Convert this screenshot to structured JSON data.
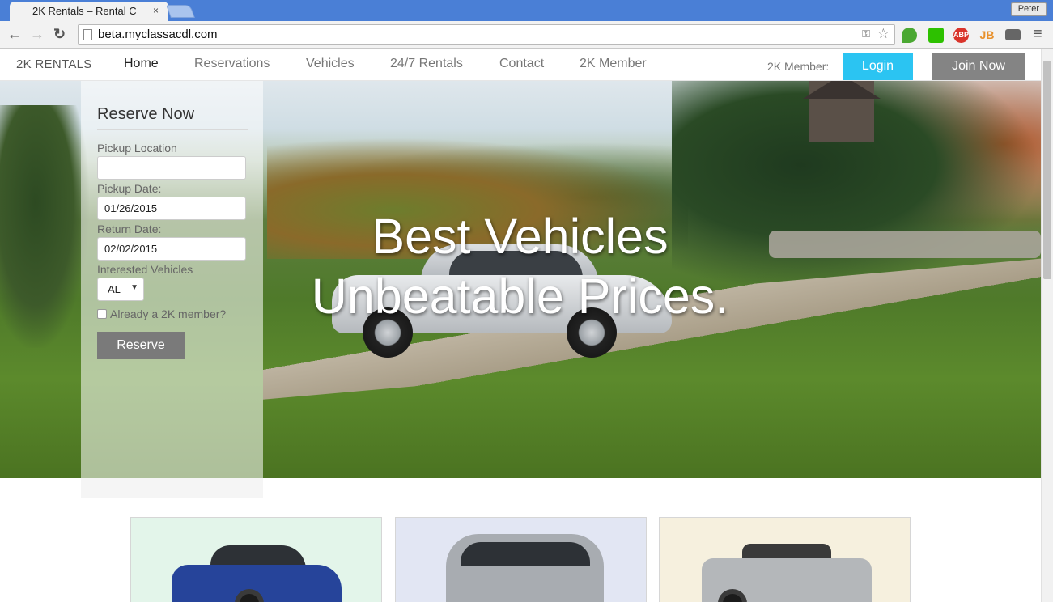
{
  "browser": {
    "tab_title": "2K Rentals – Rental C",
    "tab_close": "×",
    "profile_name": "Peter",
    "url": "beta.myclassacdl.com",
    "back_glyph": "←",
    "forward_glyph": "→",
    "reload_glyph": "↻",
    "menu_glyph": "≡",
    "star_glyph": "☆",
    "extensions": [
      {
        "name": "evernote-icon",
        "label": "",
        "color": "#4aa832"
      },
      {
        "name": "wechat-icon",
        "label": "",
        "color": "#2dc100"
      },
      {
        "name": "adblock-plus-icon",
        "label": "ABP",
        "color": "#d9342b"
      },
      {
        "name": "jb-icon",
        "label": "JB",
        "color": "#f0a030"
      },
      {
        "name": "mail-icon",
        "label": "",
        "color": "#666666"
      }
    ]
  },
  "nav": {
    "brand": "2K RENTALS",
    "links": [
      "Home",
      "Reservations",
      "Vehicles",
      "24/7 Rentals",
      "Contact",
      "2K Member"
    ],
    "active_index": 0,
    "member_label": "2K Member:",
    "login_label": "Login",
    "join_label": "Join Now"
  },
  "hero": {
    "headline_line1": "Best Vehicles",
    "headline_line2": "Unbeatable Prices."
  },
  "reserve_form": {
    "title": "Reserve Now",
    "pickup_location_label": "Pickup Location",
    "pickup_location_value": "",
    "pickup_date_label": "Pickup Date:",
    "pickup_date_value": "01/26/2015",
    "return_date_label": "Return Date:",
    "return_date_value": "02/02/2015",
    "vehicles_label": "Interested Vehicles",
    "vehicles_selected": "AL",
    "member_checkbox_label": "Already a 2K member?",
    "member_checkbox_checked": false,
    "submit_label": "Reserve"
  },
  "vehicle_cards": [
    {
      "name": "sedan",
      "bg": "#e3f5ea",
      "car_color": "#26449a"
    },
    {
      "name": "minivan",
      "bg": "#e2e6f3",
      "car_color": "#a8acb1"
    },
    {
      "name": "convertible",
      "bg": "#f6f0de",
      "car_color": "#b4b7ba"
    }
  ],
  "colors": {
    "login_button": "#2bc4f2",
    "join_button": "#848484",
    "reserve_button": "#7a7a7a"
  }
}
